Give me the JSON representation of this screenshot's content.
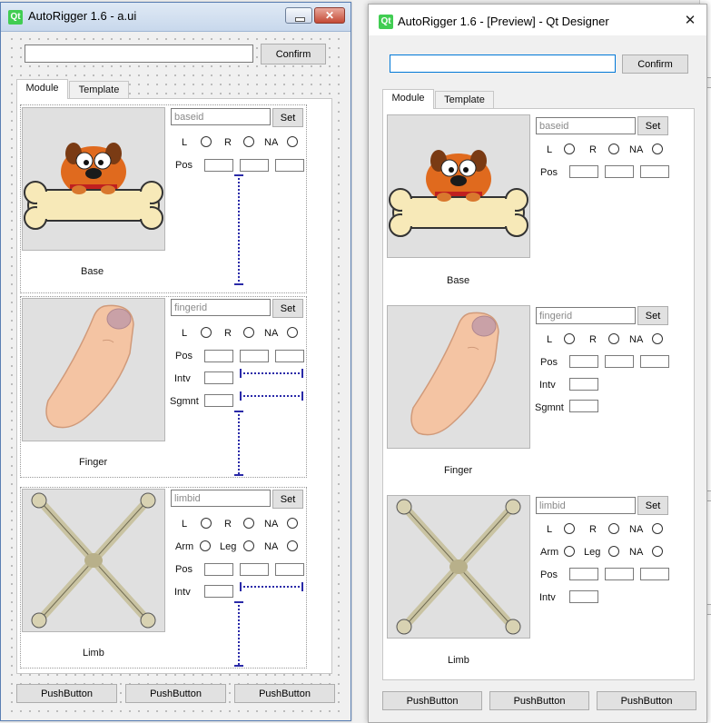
{
  "design_window": {
    "title": "AutoRigger 1.6 - a.ui",
    "logo": "Qt"
  },
  "preview_window": {
    "title": "AutoRigger 1.6 - [Preview] - Qt Designer",
    "logo": "Qt"
  },
  "top_bar": {
    "input_value": "",
    "confirm_label": "Confirm"
  },
  "tabs": [
    {
      "label": "Module",
      "active": true
    },
    {
      "label": "Template",
      "active": false
    }
  ],
  "modules": {
    "base": {
      "caption": "Base",
      "id_placeholder": "baseid",
      "set_label": "Set",
      "side_radios": [
        "L",
        "R",
        "NA"
      ],
      "pos_label": "Pos"
    },
    "finger": {
      "caption": "Finger",
      "id_placeholder": "fingerid",
      "set_label": "Set",
      "side_radios": [
        "L",
        "R",
        "NA"
      ],
      "pos_label": "Pos",
      "intv_label": "Intv",
      "sgmnt_label": "Sgmnt"
    },
    "limb": {
      "caption": "Limb",
      "id_placeholder": "limbid",
      "set_label": "Set",
      "side_radios": [
        "L",
        "R",
        "NA"
      ],
      "type_radios": [
        "Arm",
        "Leg",
        "NA"
      ],
      "pos_label": "Pos",
      "intv_label": "Intv"
    }
  },
  "bottom_buttons": [
    "PushButton",
    "PushButton",
    "PushButton"
  ],
  "icons": {
    "base_image": "dog-on-bone-icon",
    "finger_image": "finger-icon",
    "limb_image": "crossed-bones-icon"
  },
  "colors": {
    "qt_green": "#41cd52",
    "spacer_blue": "#2a2aa8",
    "focus_blue": "#0078d7"
  }
}
